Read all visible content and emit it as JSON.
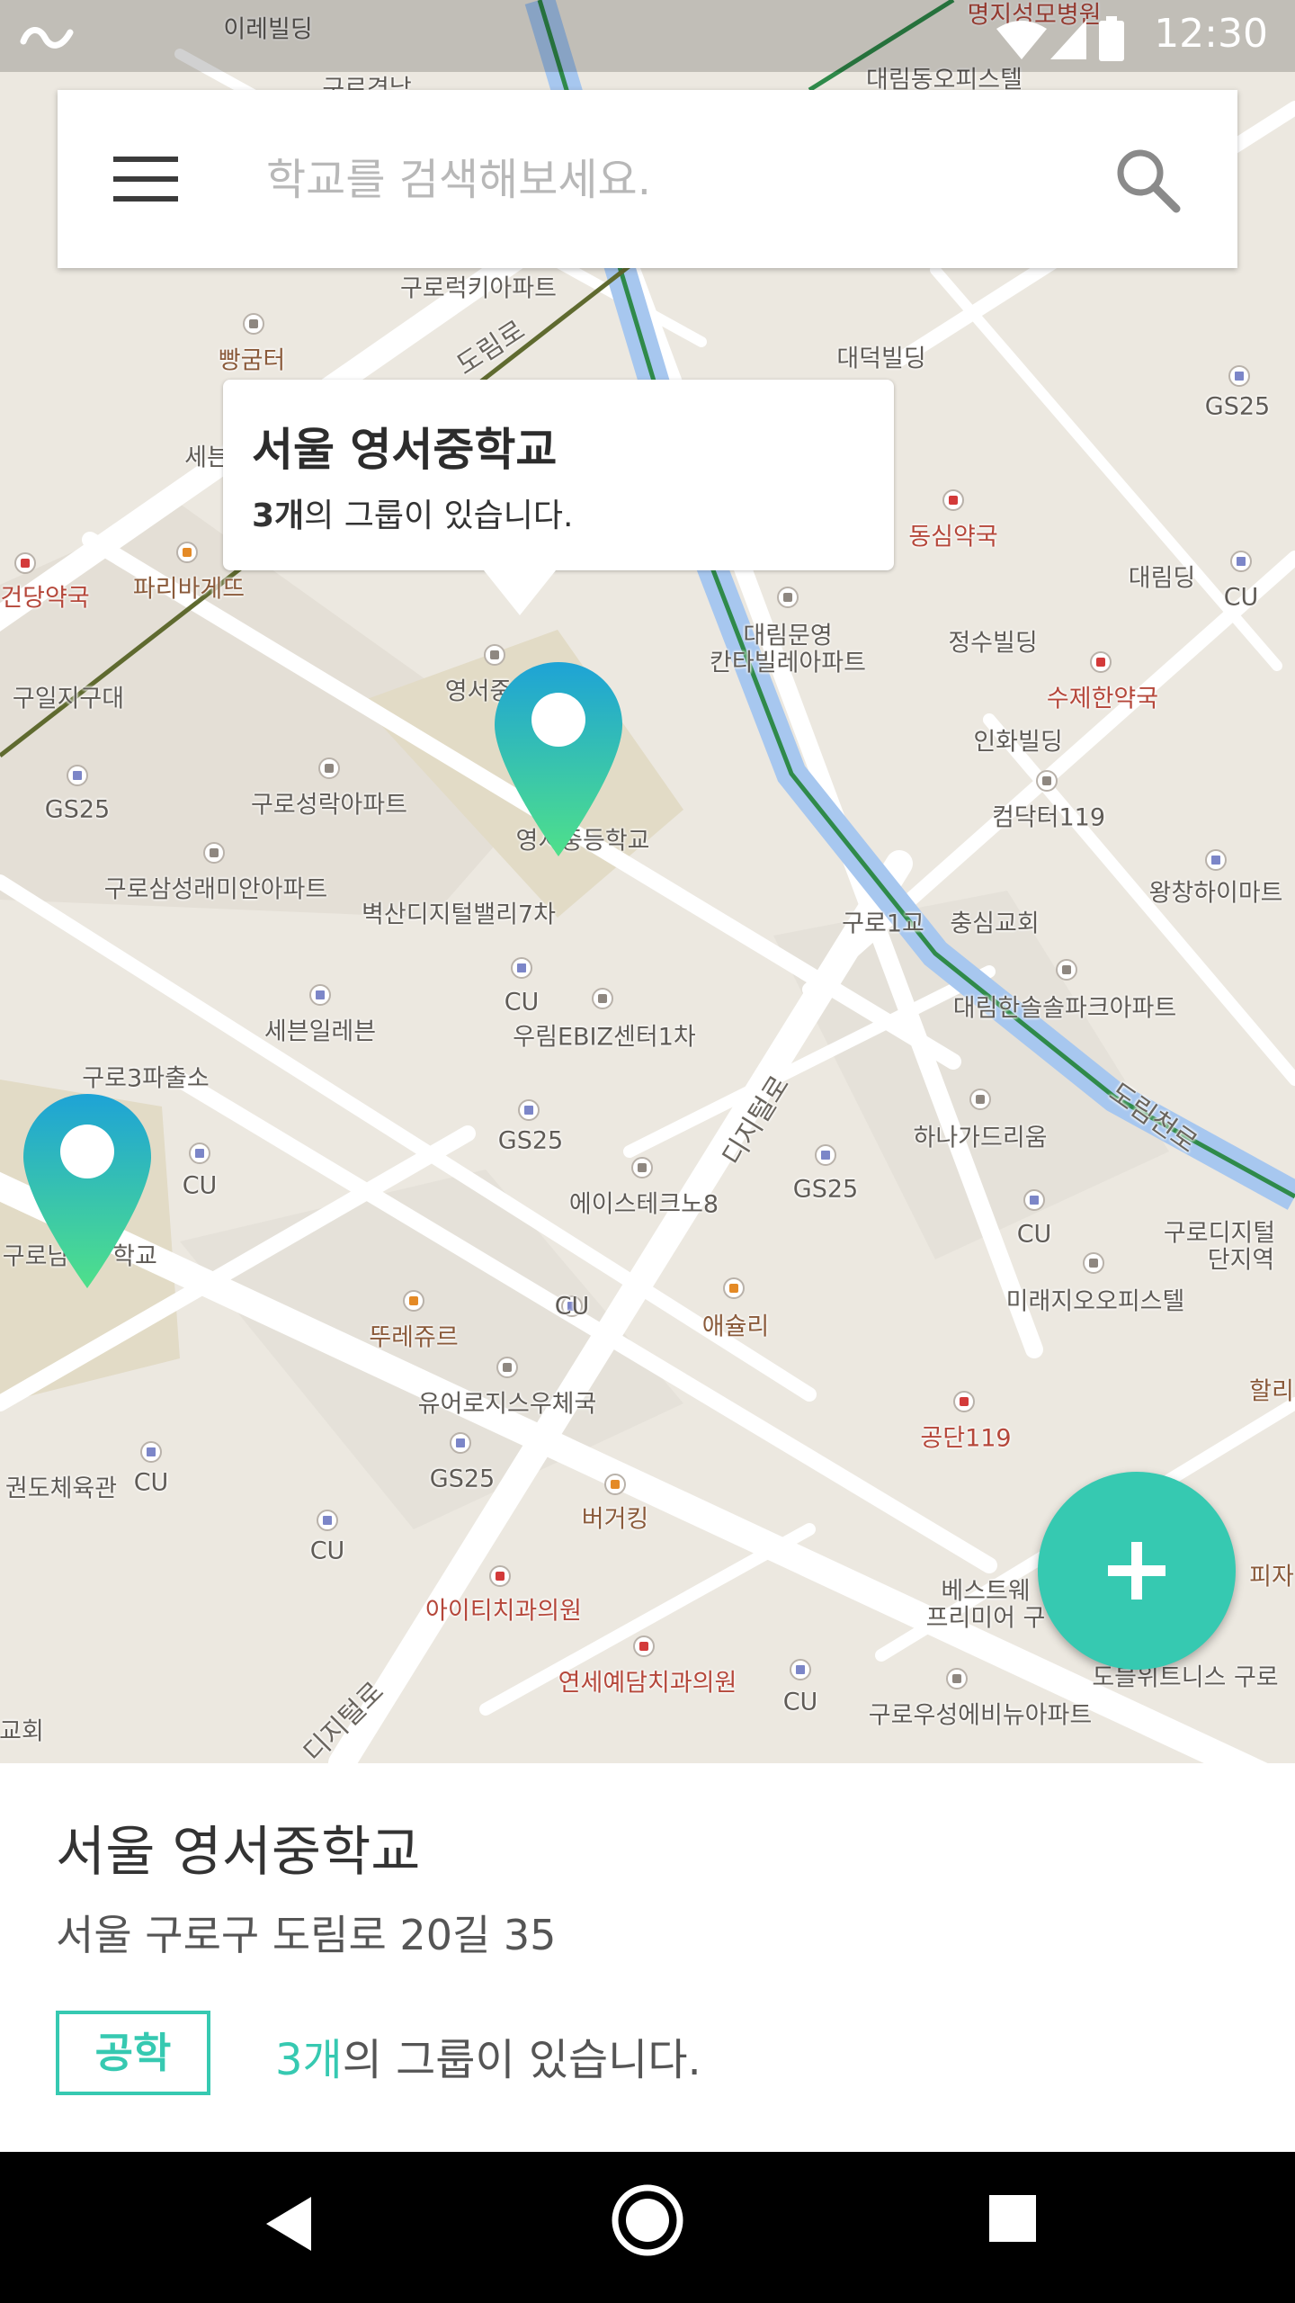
{
  "status_bar": {
    "time": "12:30",
    "icons": [
      "app-icon",
      "wifi-icon",
      "cell-signal-icon",
      "battery-icon"
    ]
  },
  "search": {
    "placeholder": "학교를 검색해보세요.",
    "value": ""
  },
  "map": {
    "labels": [
      {
        "t": "이레빌딩",
        "c": ""
      },
      {
        "t": "구로경남",
        "c": ""
      },
      {
        "t": "명지성모병원",
        "c": "red"
      },
      {
        "t": "대림동오피스텔",
        "c": ""
      },
      {
        "t": "구로럭키아파트",
        "c": ""
      },
      {
        "t": "빵굼터",
        "c": "shop"
      },
      {
        "t": "대덕빌딩",
        "c": ""
      },
      {
        "t": "GS25",
        "c": ""
      },
      {
        "t": "세븐",
        "c": ""
      },
      {
        "t": "동심약국",
        "c": "red"
      },
      {
        "t": "파리바게뜨",
        "c": "shop"
      },
      {
        "t": "건당약국",
        "c": "red"
      },
      {
        "t": "대림딩",
        "c": ""
      },
      {
        "t": "CU",
        "c": ""
      },
      {
        "t": "대림문영",
        "c": ""
      },
      {
        "t": "칸타빌레아파트",
        "c": ""
      },
      {
        "t": "정수빌딩",
        "c": ""
      },
      {
        "t": "구일지구대",
        "c": ""
      },
      {
        "t": "영서중",
        "c": ""
      },
      {
        "t": "수제한약국",
        "c": "red"
      },
      {
        "t": "인화빌딩",
        "c": ""
      },
      {
        "t": "GS25",
        "c": ""
      },
      {
        "t": "구로성락아파트",
        "c": ""
      },
      {
        "t": "컴닥터119",
        "c": ""
      },
      {
        "t": "영서중등학교",
        "c": ""
      },
      {
        "t": "구로삼성래미안아파트",
        "c": ""
      },
      {
        "t": "왕창하이마트",
        "c": ""
      },
      {
        "t": "벽산디지털밸리7차",
        "c": ""
      },
      {
        "t": "구로1교",
        "c": ""
      },
      {
        "t": "충심교회",
        "c": ""
      },
      {
        "t": "CU",
        "c": ""
      },
      {
        "t": "세븐일레븐",
        "c": ""
      },
      {
        "t": "우림EBIZ센터1차",
        "c": ""
      },
      {
        "t": "대림한솔솔파크아파트",
        "c": ""
      },
      {
        "t": "구로3파출소",
        "c": ""
      },
      {
        "t": "디지털로",
        "c": "road"
      },
      {
        "t": "도림천로",
        "c": "road"
      },
      {
        "t": "하나가드리움",
        "c": ""
      },
      {
        "t": "GS25",
        "c": ""
      },
      {
        "t": "GS25",
        "c": ""
      },
      {
        "t": "CU",
        "c": ""
      },
      {
        "t": "에이스테크노8",
        "c": ""
      },
      {
        "t": "CU",
        "c": ""
      },
      {
        "t": "구로디지털",
        "c": ""
      },
      {
        "t": "단지역",
        "c": ""
      },
      {
        "t": "구로남",
        "c": ""
      },
      {
        "t": "학교",
        "c": ""
      },
      {
        "t": "CU",
        "c": ""
      },
      {
        "t": "미래지오오피스텔",
        "c": ""
      },
      {
        "t": "뚜레쥬르",
        "c": "shop"
      },
      {
        "t": "애슐리",
        "c": "shop"
      },
      {
        "t": "할리",
        "c": "shop"
      },
      {
        "t": "유어로지스우체국",
        "c": ""
      },
      {
        "t": "공단119",
        "c": "red"
      },
      {
        "t": "GS25",
        "c": ""
      },
      {
        "t": "권도체육관",
        "c": ""
      },
      {
        "t": "CU",
        "c": ""
      },
      {
        "t": "버거킹",
        "c": "shop"
      },
      {
        "t": "CU",
        "c": ""
      },
      {
        "t": "피자",
        "c": "shop"
      },
      {
        "t": "아이티치과의원",
        "c": "red"
      },
      {
        "t": "베스트웨",
        "c": ""
      },
      {
        "t": "프리미어 구",
        "c": ""
      },
      {
        "t": "연세예담치과의원",
        "c": "red"
      },
      {
        "t": "CU",
        "c": ""
      },
      {
        "t": "구로우성에비뉴아파트",
        "c": ""
      },
      {
        "t": "도블위트니스 구로",
        "c": ""
      },
      {
        "t": "디지털로",
        "c": "road"
      },
      {
        "t": "교회",
        "c": ""
      },
      {
        "t": "CU",
        "c": ""
      },
      {
        "t": "도림로",
        "c": "road"
      }
    ]
  },
  "info_window": {
    "title": "서울 영서중학교",
    "count": "3개",
    "suffix": "의 그룹이 있습니다."
  },
  "fab": {
    "label": "+"
  },
  "sheet": {
    "name": "서울 영서중학교",
    "address": "서울 구로구 도림로 20길 35",
    "tag": "공학",
    "count": "3개",
    "suffix": "의 그룹이 있습니다."
  },
  "colors": {
    "accent": "#36c9b1",
    "pin_top": "#1ea3d6",
    "pin_bottom": "#4fe08a"
  }
}
